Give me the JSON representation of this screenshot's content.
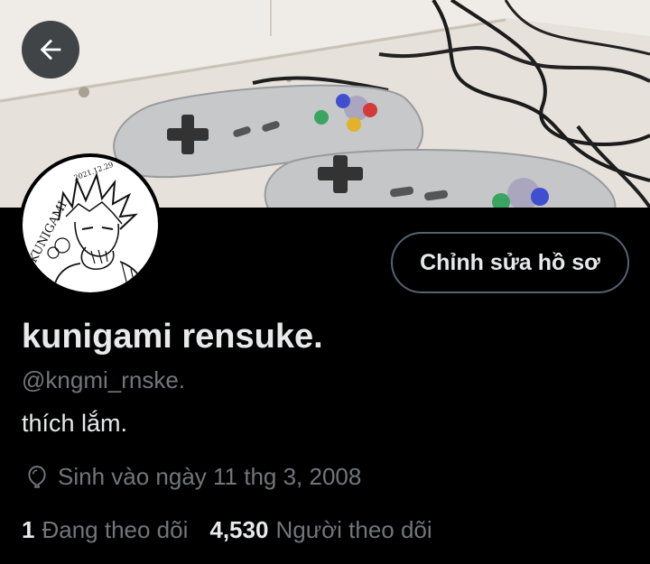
{
  "header": {
    "back_icon": "arrow-left-icon",
    "banner_icon": "game-controllers-photo"
  },
  "avatar": {
    "signature_text": "KUNIGAMI",
    "date_text": "2021.12.29"
  },
  "actions": {
    "edit_profile_label": "Chỉnh sửa hồ sơ"
  },
  "profile": {
    "display_name": "kunigami rensuke.",
    "handle": "@kngmi_rnske.",
    "bio": "thích lắm.",
    "birth_icon": "balloon-icon",
    "birth_text": "Sinh vào ngày 11 thg 3, 2008"
  },
  "stats": {
    "following_count": "1",
    "following_label": "Đang theo dõi",
    "followers_count": "4,530",
    "followers_label": "Người theo dõi"
  },
  "colors": {
    "background": "#000000",
    "primary_text": "#e7e9ea",
    "secondary_text": "#71767b",
    "button_border": "#536471"
  }
}
